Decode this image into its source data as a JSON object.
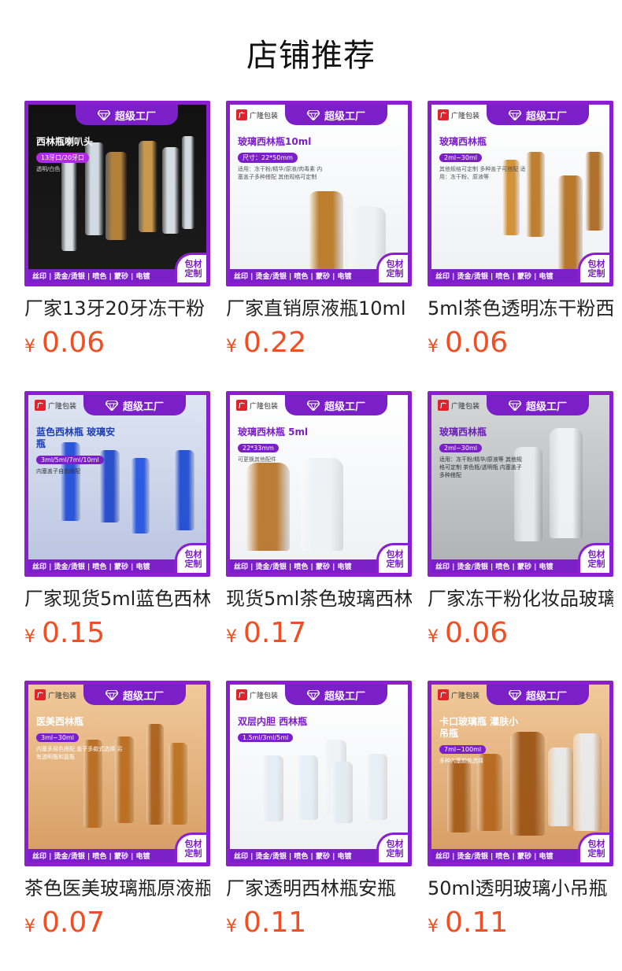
{
  "section": {
    "title": "店铺推荐"
  },
  "common": {
    "factory_badge": "超级工厂",
    "brand": "广隆包装",
    "bottom_bar": "丝印 | 烫金/烫银 | 喷色 | 蒙砂 | 电镀",
    "custom_line1": "包材",
    "custom_line2": "定制",
    "currency": "¥"
  },
  "products": [
    {
      "name": "厂家13牙20牙冻干粉",
      "price": "0.06",
      "thumb_title": "西林瓶喇叭头",
      "thumb_tag": "13牙口/20牙口",
      "thumb_desc": "透明/白色",
      "theme": "dark"
    },
    {
      "name": "厂家直销原液瓶10ml",
      "price": "0.22",
      "thumb_title": "玻璃西林瓶10ml",
      "thumb_tag": "尺寸：22*50mm",
      "thumb_desc": "适用：冻干粉/精华/原液/肉毒素 内塞盖子多种搭配 其他规格可定制",
      "theme": "light"
    },
    {
      "name": "5ml茶色透明冻干粉西",
      "price": "0.06",
      "thumb_title": "玻璃西林瓶",
      "thumb_tag": "2ml~30ml",
      "thumb_desc": "其他规格可定制 多种盖子可搭配 适用：冻干粉、原液等",
      "theme": "light"
    },
    {
      "name": "厂家现货5ml蓝色西林",
      "price": "0.15",
      "thumb_title": "蓝色西林瓶 玻璃安瓶",
      "thumb_tag": "3ml/5ml/7ml/10ml",
      "thumb_desc": "内塞盖子自由搭配",
      "theme": "blue"
    },
    {
      "name": "现货5ml茶色玻璃西林",
      "price": "0.17",
      "thumb_title": "玻璃西林瓶 5ml",
      "thumb_tag": "22*33mm",
      "thumb_desc": "可更换其他配件",
      "theme": "light"
    },
    {
      "name": "厂家冻干粉化妆品玻璃",
      "price": "0.06",
      "thumb_title": "玻璃西林瓶",
      "thumb_tag": "2ml~30ml",
      "thumb_desc": "适用：冻干粉/精华/原液等 其他规格可定制 茶色瓶/透明瓶 内塞盖子多种搭配",
      "theme": "grey"
    },
    {
      "name": "茶色医美玻璃瓶原液瓶",
      "price": "0.07",
      "thumb_title": "医美西林瓶",
      "thumb_tag": "3ml~30ml",
      "thumb_desc": "内塞多层色搭配 盖子多款式选择 另有透明瓶和蓝瓶",
      "theme": "warm"
    },
    {
      "name": "厂家透明西林瓶安瓶",
      "price": "0.11",
      "thumb_title": "双层内胆 西林瓶",
      "thumb_tag": "1.5ml/3ml/5ml",
      "thumb_desc": "",
      "theme": "light"
    },
    {
      "name": "50ml透明玻璃小吊瓶",
      "price": "0.11",
      "thumb_title": "卡口玻璃瓶 灌肤小吊瓶",
      "thumb_tag": "7ml~100ml",
      "thumb_desc": "多种内塞颜色选择",
      "theme": "warm"
    }
  ],
  "colors": {
    "accent_purple": "#7b1fc9",
    "price_orange": "#f04e23"
  }
}
